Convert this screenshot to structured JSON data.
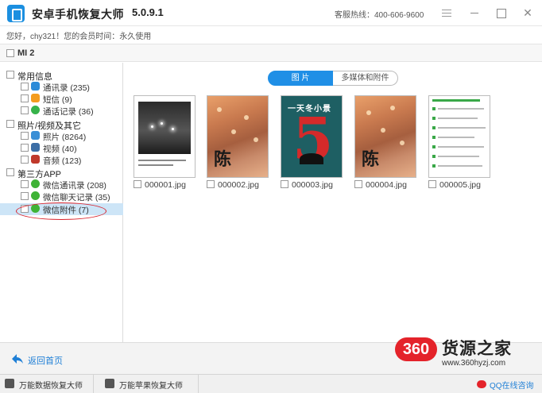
{
  "app": {
    "title": "安卓手机恢复大师",
    "version": "5.0.9.1",
    "hotline": "客服热线：400-606-9600",
    "user_info": "您好，chy321！您的会员时间：永久使用"
  },
  "device": {
    "name": "MI 2"
  },
  "sidebar": {
    "categories": [
      {
        "label": "常用信息",
        "items": [
          {
            "label": "通讯录 (235)",
            "icon": "contacts-icon"
          },
          {
            "label": "短信 (9)",
            "icon": "sms-icon"
          },
          {
            "label": "通话记录 (36)",
            "icon": "call-log-icon"
          }
        ]
      },
      {
        "label": "照片/视频及其它",
        "items": [
          {
            "label": "照片 (8264)",
            "icon": "photo-icon"
          },
          {
            "label": "视频 (40)",
            "icon": "video-icon"
          },
          {
            "label": "音频 (123)",
            "icon": "audio-icon"
          }
        ]
      },
      {
        "label": "第三方APP",
        "items": [
          {
            "label": "微信通讯录 (208)",
            "icon": "wechat-icon"
          },
          {
            "label": "微信聊天记录 (35)",
            "icon": "wechat-icon"
          },
          {
            "label": "微信附件 (7)",
            "icon": "wechat-icon",
            "selected": true
          }
        ]
      }
    ]
  },
  "tabs": [
    {
      "label": "图 片",
      "active": true
    },
    {
      "label": "多媒体和附件",
      "active": false
    }
  ],
  "files": [
    {
      "name": "000001.jpg"
    },
    {
      "name": "000002.jpg"
    },
    {
      "name": "000003.jpg",
      "poster_heading": "一天冬小景"
    },
    {
      "name": "000004.jpg"
    },
    {
      "name": "000005.jpg"
    }
  ],
  "thumb_text": {
    "chen": "陈",
    "five": "5"
  },
  "footer": {
    "back_label": "返回首页"
  },
  "watermark": {
    "badge": "360",
    "title": "货源之家",
    "url": "www.360hyzj.com"
  },
  "taskbar": {
    "items": [
      {
        "label": "万能数据恢复大师"
      },
      {
        "label": "万能苹果恢复大师"
      }
    ],
    "qq": "QQ在线咨询"
  },
  "colors": {
    "accent": "#1f8fe6",
    "selected_row": "#cde5f7",
    "highlight": "#d9232d",
    "watermark_red": "#e4232a"
  }
}
